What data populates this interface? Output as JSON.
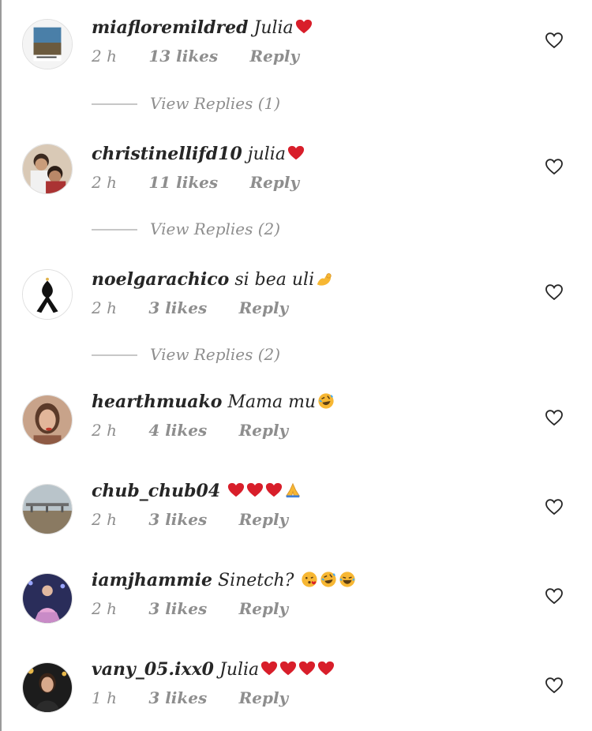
{
  "comments": [
    {
      "username": "miafloremildred",
      "text": "Julia",
      "emoji": [
        "red-heart"
      ],
      "time": "2 h",
      "likes": "13 likes",
      "reply": "Reply",
      "view_replies": "View Replies (1)"
    },
    {
      "username": "christinellifd10",
      "text": "julia",
      "emoji": [
        "red-heart"
      ],
      "time": "2 h",
      "likes": "11 likes",
      "reply": "Reply",
      "view_replies": "View Replies (2)"
    },
    {
      "username": "noelgarachico",
      "text": "si bea uli",
      "emoji": [
        "flexed-biceps"
      ],
      "time": "2 h",
      "likes": "3 likes",
      "reply": "Reply",
      "view_replies": "View Replies (2)"
    },
    {
      "username": "hearthmuako",
      "text": "Mama mu",
      "emoji": [
        "rolling-laughing"
      ],
      "time": "2 h",
      "likes": "4 likes",
      "reply": "Reply"
    },
    {
      "username": "chub_chub04",
      "text": "",
      "emoji": [
        "red-heart",
        "red-heart",
        "red-heart",
        "folded-hands"
      ],
      "time": "2 h",
      "likes": "3 likes",
      "reply": "Reply"
    },
    {
      "username": "iamjhammie",
      "text": "Sinetch?",
      "emoji": [
        "kissing-face",
        "rolling-laughing",
        "tears-of-joy"
      ],
      "time": "2 h",
      "likes": "3 likes",
      "reply": "Reply"
    },
    {
      "username": "vany_05.ixx0",
      "text": "Julia",
      "emoji": [
        "red-heart",
        "red-heart",
        "red-heart",
        "red-heart"
      ],
      "time": "1 h",
      "likes": "3 likes",
      "reply": "Reply"
    }
  ],
  "icons": {
    "like": "heart-outline-icon"
  },
  "colors": {
    "text": "#262626",
    "secondary": "#8e8e8e",
    "heart": "#d81e2a",
    "emoji_yellow": "#f7b733"
  }
}
